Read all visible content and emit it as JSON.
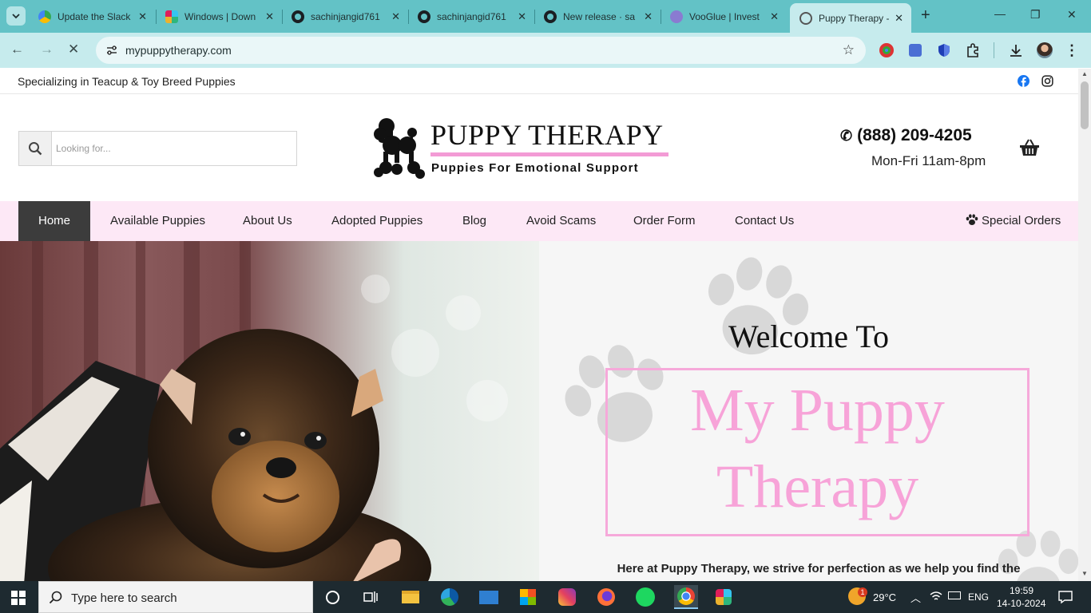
{
  "browser": {
    "tabs": [
      {
        "title": "Update the Slack",
        "fav_color": "#34a853"
      },
      {
        "title": "Windows | Down",
        "fav_color": "#e01e5a"
      },
      {
        "title": "sachinjangid761",
        "fav_color": "#1b1f23"
      },
      {
        "title": "sachinjangid761",
        "fav_color": "#1b1f23"
      },
      {
        "title": "New release · sa",
        "fav_color": "#1b1f23"
      },
      {
        "title": "VooGlue | Invest",
        "fav_color": "#8a7bd1"
      },
      {
        "title": "Puppy Therapy -",
        "fav_color": "#555555"
      }
    ],
    "url": "mypuppytherapy.com"
  },
  "site": {
    "tagline": "Specializing in Teacup & Toy Breed Puppies",
    "search_placeholder": "Looking for...",
    "logo_title": "PUPPY THERAPY",
    "logo_subtitle": "Puppies For Emotional Support",
    "phone": "(888) 209-4205",
    "hours": "Mon-Fri 11am-8pm",
    "nav": [
      {
        "label": "Home"
      },
      {
        "label": "Available Puppies"
      },
      {
        "label": "About Us"
      },
      {
        "label": "Adopted Puppies"
      },
      {
        "label": "Blog"
      },
      {
        "label": "Avoid Scams"
      },
      {
        "label": "Order Form"
      },
      {
        "label": "Contact Us"
      }
    ],
    "special_orders": "Special Orders",
    "hero": {
      "welcome": "Welcome To",
      "name_line1": "My Puppy",
      "name_line2": "Therapy",
      "intro": "Here at Puppy Therapy, we strive for perfection as we help you find the"
    },
    "accent_pink": "#f7a3d8",
    "nav_bg": "#fde8f6"
  },
  "taskbar": {
    "search_placeholder": "Type here to search",
    "weather": "29°C",
    "weather_badge": "1",
    "lang": "ENG",
    "time": "19:59",
    "date": "14-10-2024"
  }
}
